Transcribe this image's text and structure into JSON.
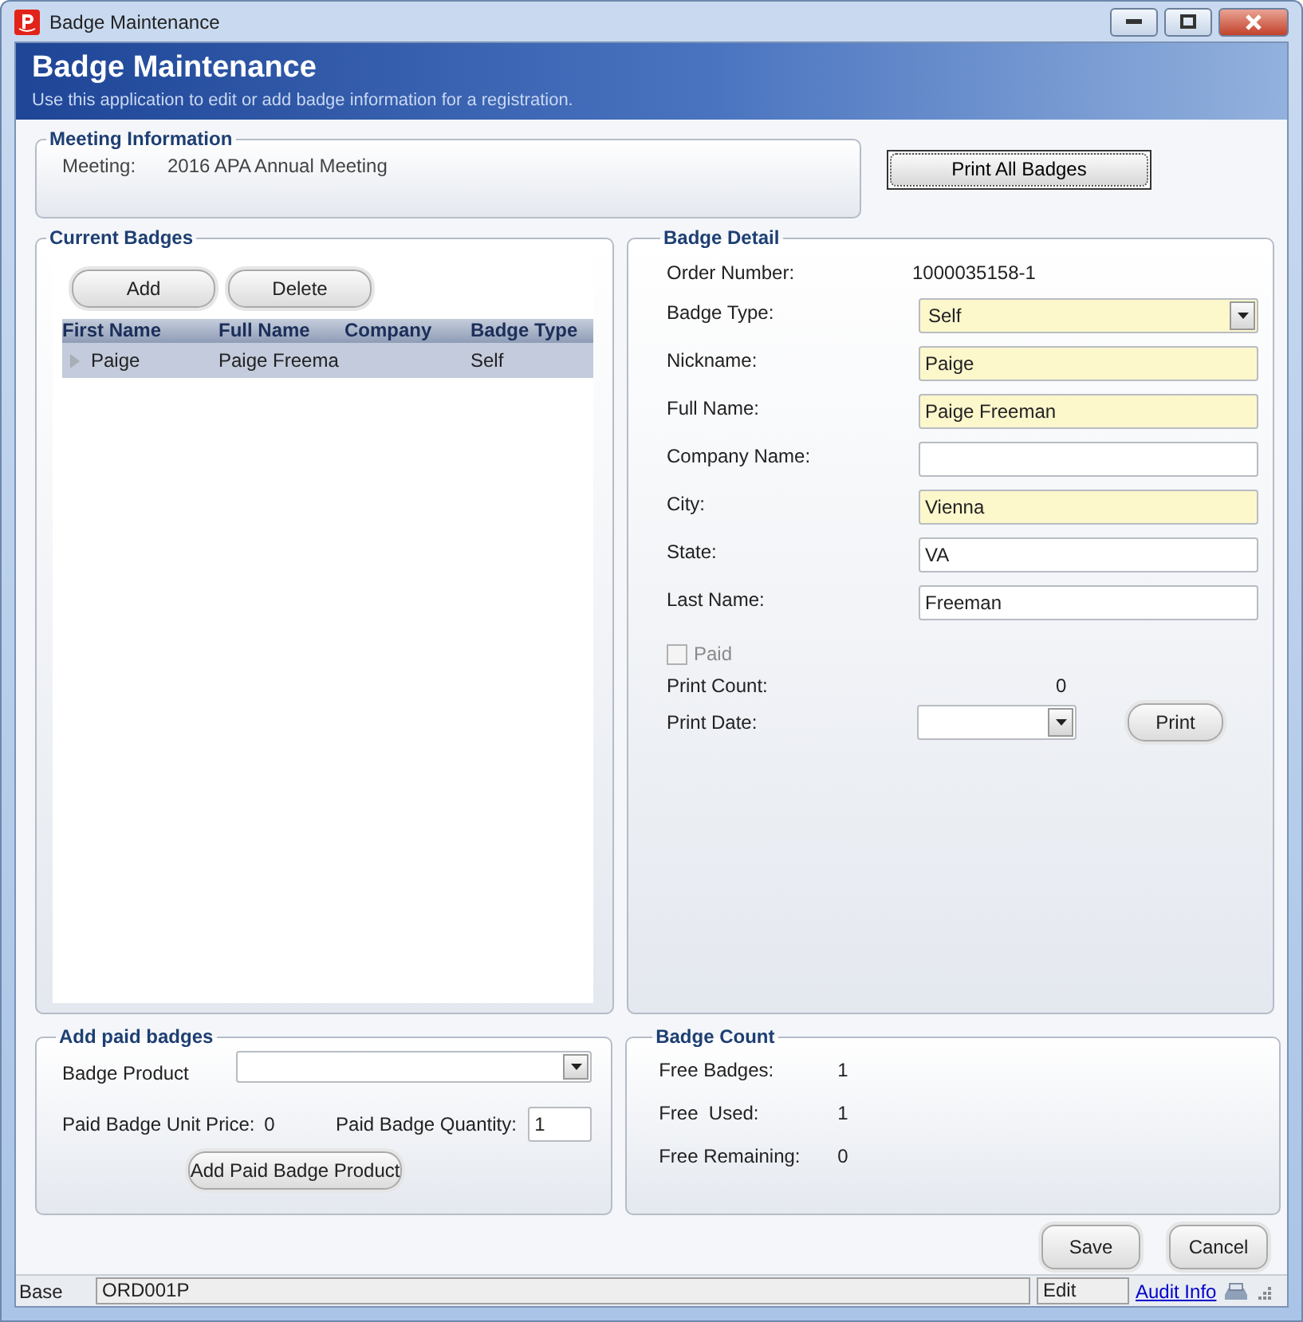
{
  "window": {
    "title": "Badge Maintenance"
  },
  "header": {
    "title": "Badge Maintenance",
    "subtitle": "Use this application to edit or add badge information for a registration."
  },
  "meeting_information": {
    "legend": "Meeting Information",
    "label": "Meeting:",
    "value": "2016 APA Annual Meeting"
  },
  "print_all_button": "Print All Badges",
  "current_badges": {
    "legend": "Current Badges",
    "buttons": [
      "Add",
      "Delete"
    ],
    "columns": [
      "First Name",
      "Full Name",
      "Company",
      "Badge Type"
    ],
    "rows": [
      {
        "cells": [
          "Paige",
          "Paige Freema",
          "",
          "Self"
        ],
        "selected": true
      }
    ]
  },
  "badge_detail": {
    "legend": "Badge Detail",
    "order_number": {
      "label": "Order Number:",
      "value": "1000035158-1"
    },
    "fields": [
      {
        "label": "Badge Type:",
        "value": "Self",
        "kind": "select",
        "required": true
      },
      {
        "label": "Nickname:",
        "value": "Paige",
        "kind": "text",
        "required": true
      },
      {
        "label": "Full Name:",
        "value": "Paige Freeman",
        "kind": "text",
        "required": true
      },
      {
        "label": "Company Name:",
        "kind": "text",
        "required": false
      },
      {
        "label": "City:",
        "value": "Vienna",
        "kind": "text",
        "required": true
      },
      {
        "label": "State:",
        "value": "VA",
        "kind": "text",
        "required": false
      },
      {
        "label": "Last Name:",
        "value": "Freeman",
        "kind": "text",
        "required": false
      }
    ],
    "paid": {
      "label": "Paid",
      "checked": false,
      "disabled": true
    },
    "print_count": {
      "label": "Print Count:",
      "value": "0"
    },
    "print_date": {
      "label": "Print Date:"
    },
    "print_button": "Print"
  },
  "add_paid_badges": {
    "legend": "Add paid badges",
    "product_label": "Badge Product",
    "unit_price_label": "Paid Badge Unit Price:",
    "unit_price": "0",
    "quantity_label": "Paid Badge Quantity:",
    "quantity": "1",
    "add_button": "Add Paid Badge Product"
  },
  "badge_count": {
    "legend": "Badge Count",
    "items": [
      {
        "label": "Free Badges:",
        "value": "1"
      },
      {
        "label": "Free  Used:",
        "value": "1"
      },
      {
        "label": "Free Remaining:",
        "value": "0"
      }
    ]
  },
  "buttons": [
    "Save",
    "Cancel"
  ],
  "status_bar": {
    "mode": "Base",
    "form": "ORD001P",
    "state": "Edit",
    "link": "Audit Info"
  }
}
